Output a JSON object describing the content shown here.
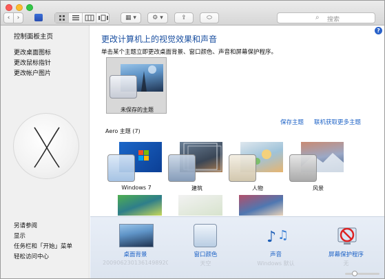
{
  "toolbar": {
    "back_glyph": "‹",
    "forward_glyph": "›",
    "search_placeholder": "搜索",
    "view_icons": [
      "icon-grid-icon",
      "list-view-icon",
      "column-view-icon",
      "gallery-view-icon"
    ],
    "arrange_glyph": "▦ ▾",
    "action_glyph": "⚙ ▾",
    "share_glyph": "⇪",
    "tag_glyph": "⬭"
  },
  "sidebar": {
    "home": "控制面板主页",
    "links": [
      "更改桌面图标",
      "更改鼠标指针",
      "更改帐户图片"
    ],
    "see_also": [
      "另请参阅",
      "显示",
      "任务栏和「开始」菜单",
      "轻松访问中心"
    ]
  },
  "main": {
    "title": "更改计算机上的视觉效果和声音",
    "subtitle": "单击某个主题立即更改桌面背景、窗口颜色、声音和屏幕保护程序。",
    "help_glyph": "?",
    "unsaved_theme_label": "未保存的主题",
    "save_theme_link": "保存主题",
    "more_themes_link": "联机获取更多主题",
    "aero_section": "Aero 主题 (7)",
    "themes": [
      {
        "name": "Windows 7"
      },
      {
        "name": "建筑"
      },
      {
        "name": "人物"
      },
      {
        "name": "风景"
      }
    ]
  },
  "bottom": [
    {
      "label": "桌面背景",
      "value": "20090623013614989203..."
    },
    {
      "label": "窗口颜色",
      "value": "天空"
    },
    {
      "label": "声音",
      "value": "Windows 默认"
    },
    {
      "label": "屏幕保护程序",
      "value": "无"
    }
  ],
  "colors": {
    "title_blue": "#1a4fa0",
    "link_blue": "#1d62c6",
    "bottom_bg": "#e3eaf4"
  }
}
